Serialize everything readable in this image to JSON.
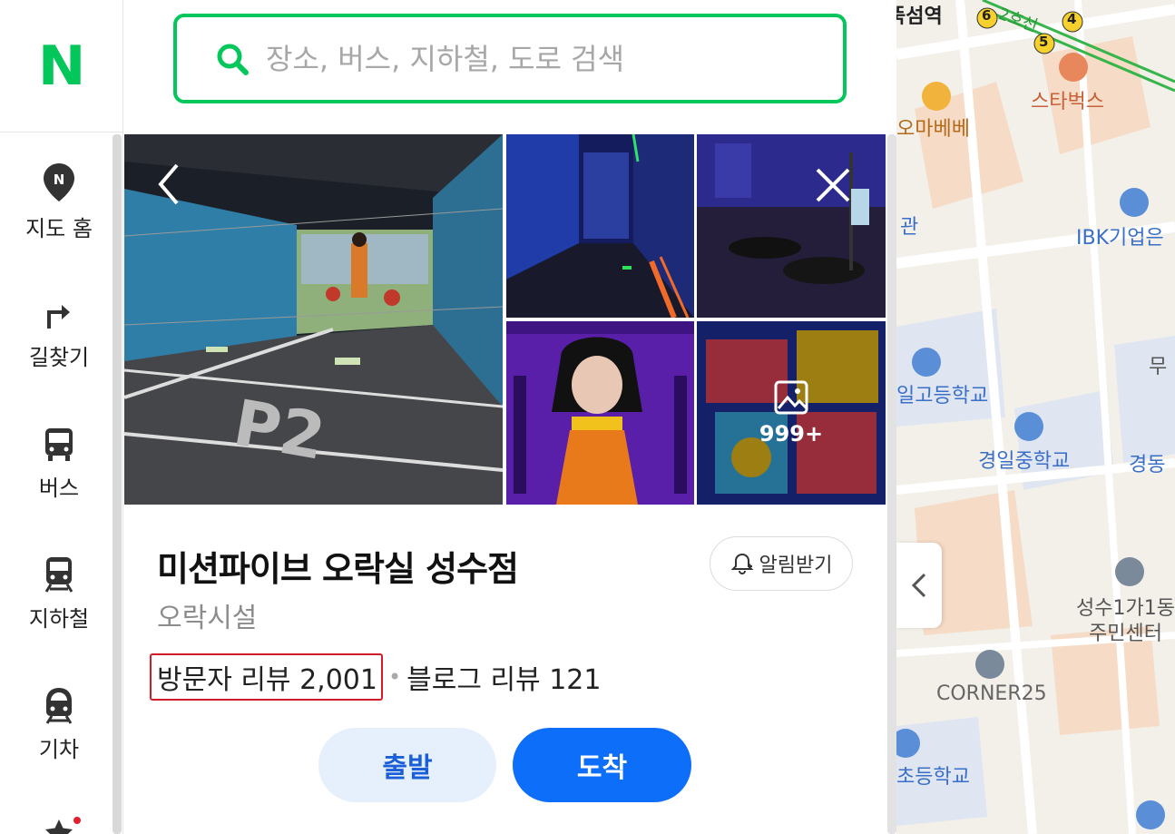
{
  "brand": {
    "logo": "N",
    "color": "#03c75a"
  },
  "search": {
    "placeholder": "장소, 버스, 지하철, 도로 검색",
    "icon": "search-icon"
  },
  "sidebar": {
    "items": [
      {
        "label": "지도 홈",
        "icon": "map-pin-icon"
      },
      {
        "label": "길찾기",
        "icon": "turn-right-icon"
      },
      {
        "label": "버스",
        "icon": "bus-icon"
      },
      {
        "label": "지하철",
        "icon": "subway-icon"
      },
      {
        "label": "기차",
        "icon": "train-icon"
      }
    ]
  },
  "place": {
    "name": "미션파이브 오락실 성수점",
    "category": "오락시설",
    "visitor_reviews": "방문자 리뷰 2,001",
    "blog_reviews": "블로그 리뷰 121",
    "alarm_label": "알림받기",
    "start_label": "출발",
    "end_label": "도착",
    "photos_more": "999+"
  },
  "map": {
    "labels": {
      "station": "뚝섬역",
      "line": "2호선",
      "starbucks": "스타벅스",
      "omamebe": "오마베베",
      "gwan": "관",
      "ibk": "IBK기업은",
      "mu": "무",
      "highschool": "일고등학교",
      "middleschool": "경일중학교",
      "gyeongdong": "경동",
      "community1": "성수1가1동",
      "community2": "주민센터",
      "corner": "CORNER25",
      "elementary": "초등학교"
    },
    "exits": [
      "6",
      "4",
      "5"
    ]
  },
  "colors": {
    "accent": "#03c75a",
    "primary": "#0d6ef9",
    "highlight": "#d11d2a"
  }
}
